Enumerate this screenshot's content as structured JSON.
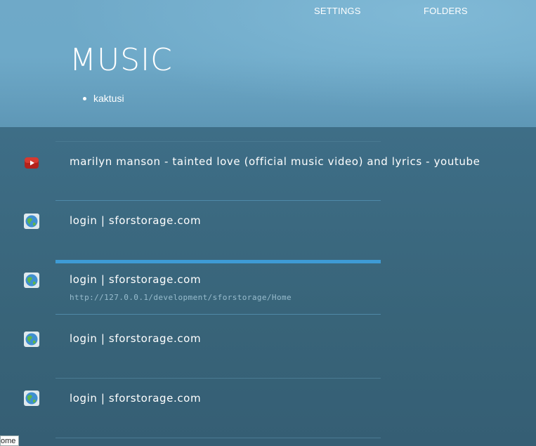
{
  "nav": {
    "settings": "SETTINGS",
    "folders": "FOLDERS"
  },
  "page": {
    "title": "MUSIC",
    "breadcrumb": "kaktusi"
  },
  "items": [
    {
      "icon": "youtube-icon",
      "title": "marilyn manson - tainted love (official music video) and lyrics - youtube",
      "url": ""
    },
    {
      "icon": "globe-icon",
      "title": "login | sforstorage.com",
      "url": ""
    },
    {
      "icon": "globe-icon",
      "title": "login | sforstorage.com",
      "url": "http://127.0.0.1/development/sforstorage/Home"
    },
    {
      "icon": "globe-icon",
      "title": "login | sforstorage.com",
      "url": ""
    },
    {
      "icon": "globe-icon",
      "title": "login | sforstorage.com",
      "url": ""
    }
  ],
  "status_tip": "ome",
  "colors": {
    "header_bg": "#6fa9c8",
    "main_bg": "#3b6980",
    "selected_bar": "#3e9bd6",
    "text": "#ffffff",
    "url_text": "#98bccd"
  }
}
